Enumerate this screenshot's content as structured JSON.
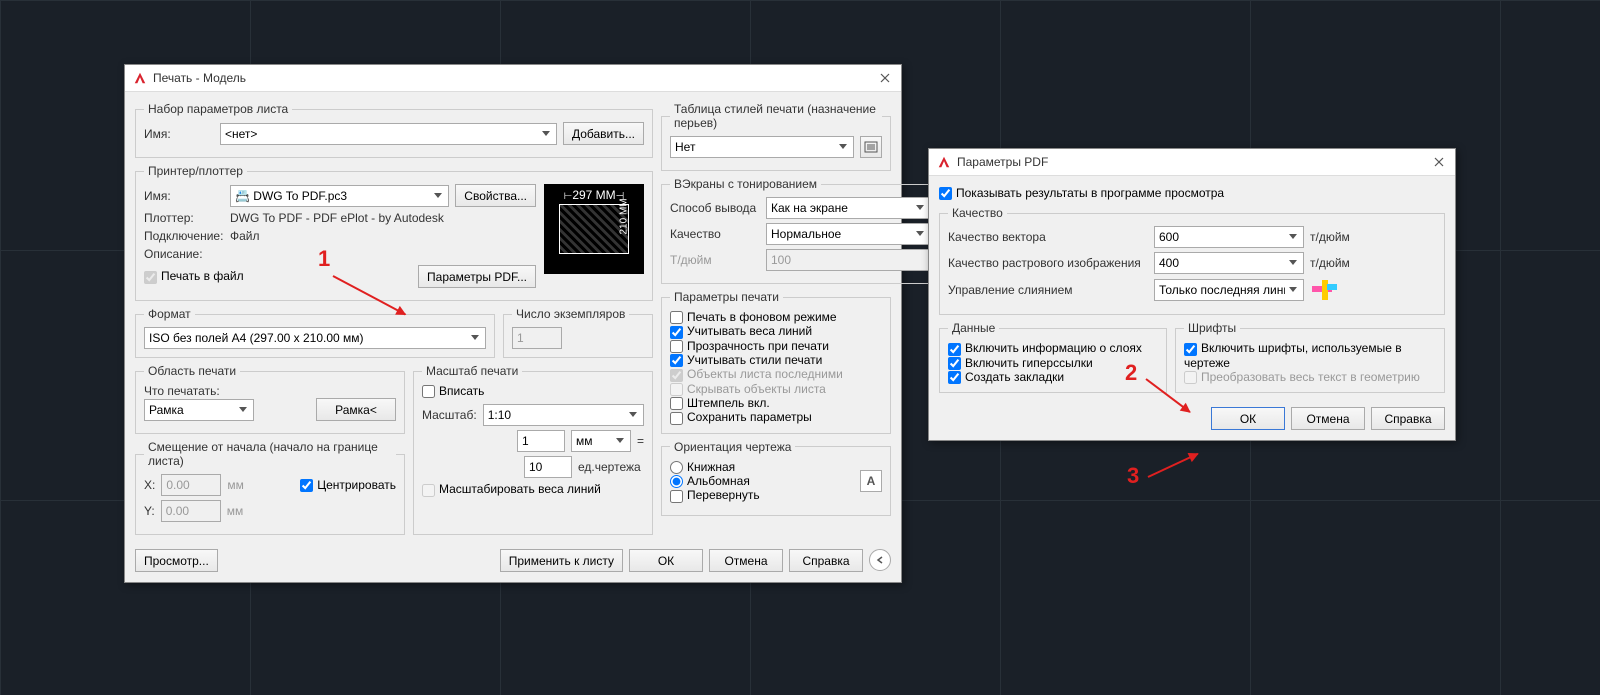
{
  "dialog1": {
    "title": "Печать - Модель",
    "pageset": {
      "legend": "Набор параметров листа",
      "name_lbl": "Имя:",
      "name_val": "<нет>",
      "add_btn": "Добавить..."
    },
    "printer": {
      "legend": "Принтер/плоттер",
      "name_lbl": "Имя:",
      "name_val": "DWG To PDF.pc3",
      "props_btn": "Свойства...",
      "plotter_lbl": "Плоттер:",
      "plotter_val": "DWG To PDF - PDF ePlot - by Autodesk",
      "conn_lbl": "Подключение:",
      "conn_val": "Файл",
      "desc_lbl": "Описание:",
      "tofile_lbl": "Печать в файл",
      "pdfparams_btn": "Параметры PDF...",
      "preview_w": "297 MM",
      "preview_h": "210 MM"
    },
    "format": {
      "legend": "Формат",
      "val": "ISO без полей A4 (297.00 x 210.00 мм)"
    },
    "copies": {
      "legend": "Число экземпляров",
      "val": "1"
    },
    "area": {
      "legend": "Область печати",
      "what_lbl": "Что печатать:",
      "what_val": "Рамка",
      "frame_btn": "Рамка<"
    },
    "offset": {
      "legend": "Смещение от начала (начало на границе листа)",
      "x_lbl": "X:",
      "x_val": "0.00",
      "y_lbl": "Y:",
      "y_val": "0.00",
      "unit": "мм",
      "center_lbl": "Центрировать"
    },
    "scale": {
      "legend": "Масштаб печати",
      "fit_lbl": "Вписать",
      "scale_lbl": "Масштаб:",
      "scale_val": "1:10",
      "num": "1",
      "unit": "мм",
      "equals": "=",
      "den": "10",
      "unit2": "ед.чертежа",
      "weight_lbl": "Масштабировать веса линий"
    },
    "styles": {
      "legend": "Таблица стилей печати (назначение перьев)",
      "val": "Нет"
    },
    "viewports": {
      "legend": "ВЭкраны с тонированием",
      "mode_lbl": "Способ вывода",
      "mode_val": "Как на экране",
      "qual_lbl": "Качество",
      "qual_val": "Нормальное",
      "dpi_lbl": "Т/дюйм",
      "dpi_val": "100"
    },
    "plotopts": {
      "legend": "Параметры печати",
      "bg": "Печать в фоновом режиме",
      "lw": "Учитывать веса линий",
      "trans": "Прозрачность при печати",
      "styles": "Учитывать стили печати",
      "paperlast": "Объекты листа последними",
      "hide": "Скрывать объекты листа",
      "stamp": "Штемпель вкл.",
      "save": "Сохранить параметры"
    },
    "orient": {
      "legend": "Ориентация чертежа",
      "port": "Книжная",
      "land": "Альбомная",
      "flip": "Перевернуть"
    },
    "footer": {
      "preview": "Просмотр...",
      "apply": "Применить к листу",
      "ok": "ОК",
      "cancel": "Отмена",
      "help": "Справка"
    }
  },
  "dialog2": {
    "title": "Параметры PDF",
    "viewresults": "Показывать результаты в программе просмотра",
    "quality": {
      "legend": "Качество",
      "vec_lbl": "Качество вектора",
      "vec_val": "600",
      "ras_lbl": "Качество растрового изображения",
      "ras_val": "400",
      "merge_lbl": "Управление слиянием",
      "merge_val": "Только последняя линия",
      "unit": "т/дюйм"
    },
    "data": {
      "legend": "Данные",
      "layers": "Включить информацию о слоях",
      "links": "Включить гиперссылки",
      "bookmarks": "Создать закладки"
    },
    "fonts": {
      "legend": "Шрифты",
      "include": "Включить шрифты, используемые в чертеже",
      "togeom": "Преобразовать весь текст в геометрию"
    },
    "footer": {
      "ok": "ОК",
      "cancel": "Отмена",
      "help": "Справка"
    }
  },
  "annot": {
    "n1": "1",
    "n2": "2",
    "n3": "3"
  }
}
